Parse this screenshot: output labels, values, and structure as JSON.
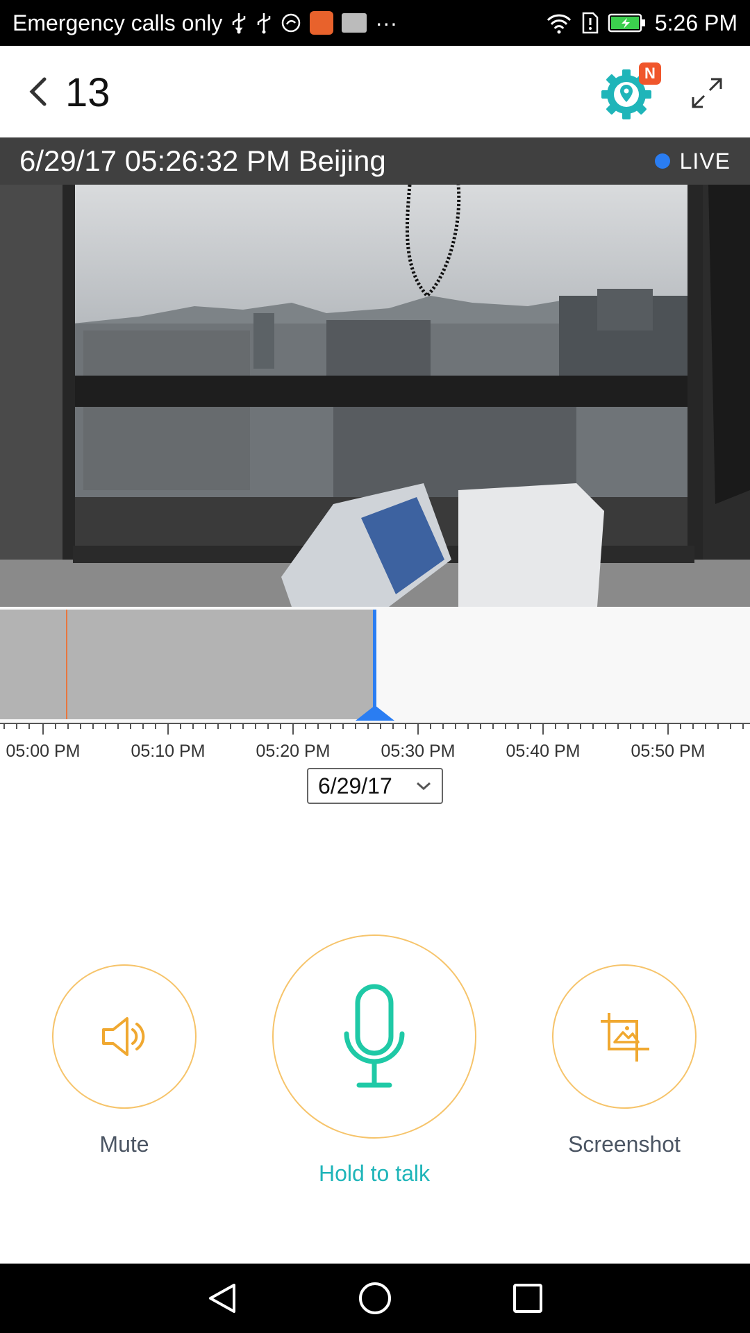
{
  "status_bar": {
    "carrier_text": "Emergency calls only",
    "more_glyph": "···",
    "time": "5:26 PM"
  },
  "header": {
    "camera_name": "13",
    "settings_badge": "N"
  },
  "info_bar": {
    "datetime": "6/29/17 05:26:32 PM Beijing",
    "live_label": "LIVE"
  },
  "timeline": {
    "labels": [
      "05:00 PM",
      "05:10 PM",
      "05:20 PM",
      "05:30 PM",
      "05:40 PM",
      "05:50 PM"
    ]
  },
  "date_select": {
    "value": "6/29/17"
  },
  "controls": {
    "mute_label": "Mute",
    "talk_label": "Hold to talk",
    "screenshot_label": "Screenshot"
  },
  "colors": {
    "accent_teal": "#1fb5b9",
    "accent_orange": "#f0a830",
    "live_blue": "#2a7df2",
    "event_orange": "#e8763d"
  },
  "icons": {
    "back": "chevron-left-icon",
    "settings": "gear-location-icon",
    "fullscreen": "expand-icon",
    "mute": "speaker-icon",
    "talk": "microphone-icon",
    "screenshot": "crop-image-icon"
  }
}
